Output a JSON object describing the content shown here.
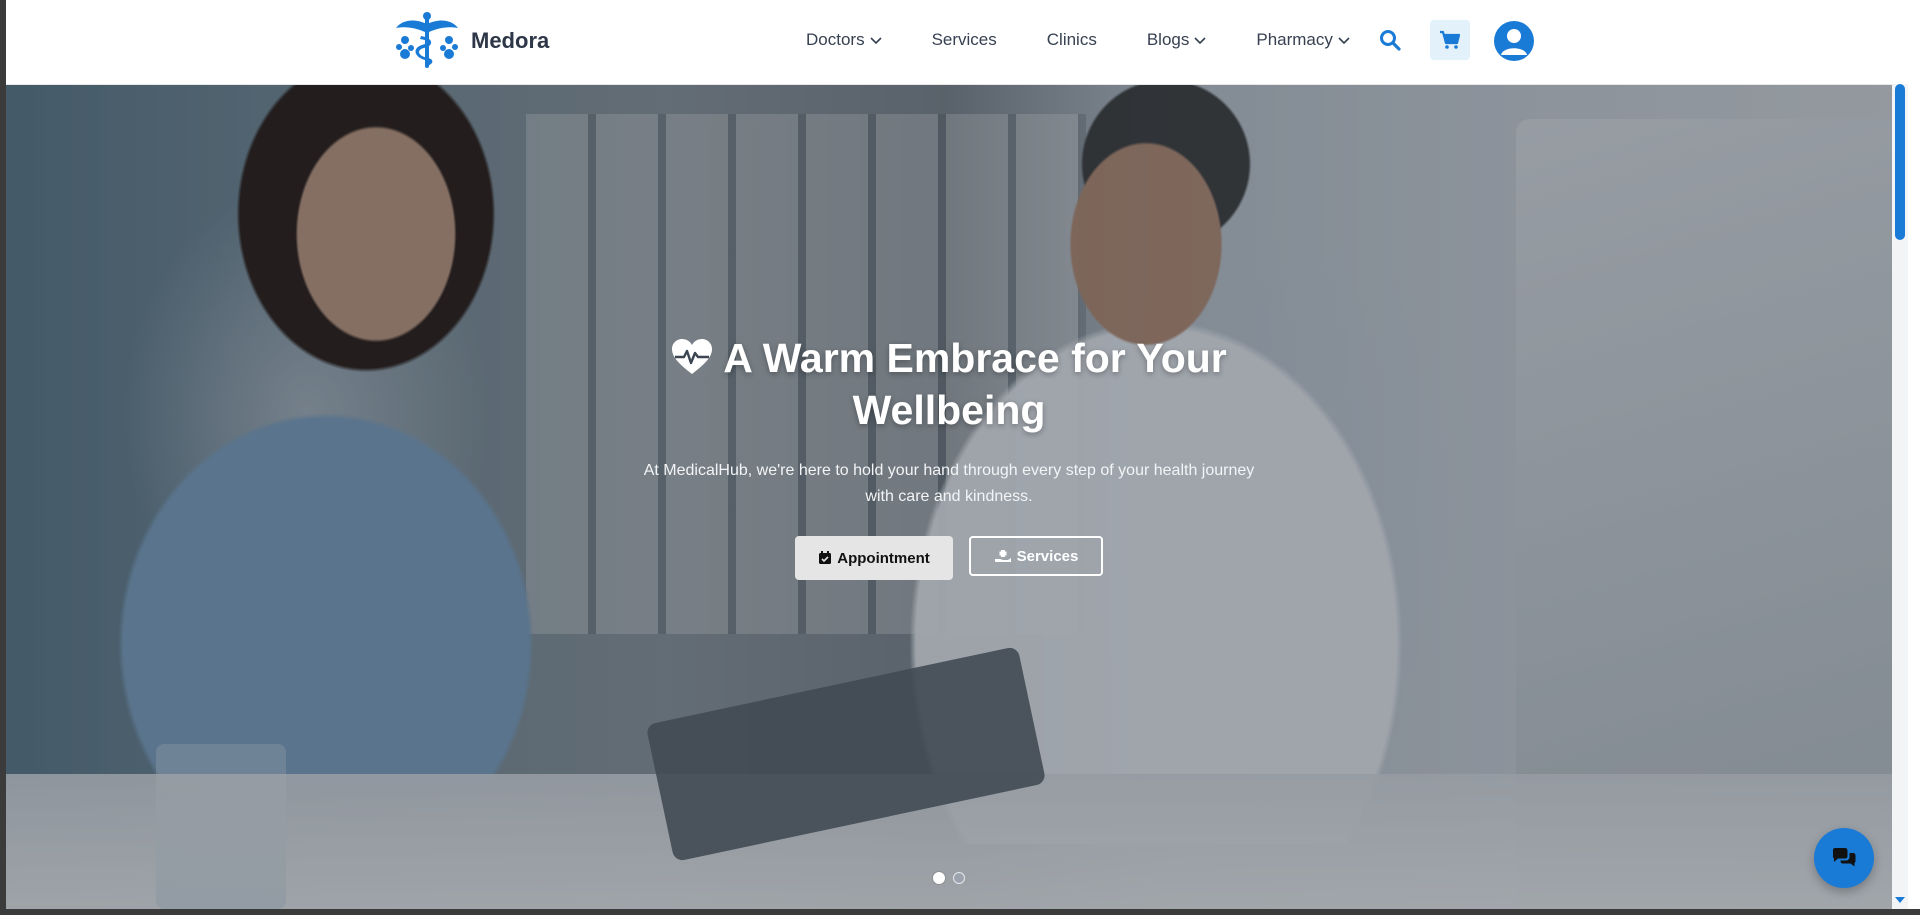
{
  "brand": {
    "name": "Medora"
  },
  "nav": {
    "items": [
      {
        "label": "Doctors",
        "has_dropdown": true
      },
      {
        "label": "Services",
        "has_dropdown": false
      },
      {
        "label": "Clinics",
        "has_dropdown": false
      },
      {
        "label": "Blogs",
        "has_dropdown": true
      },
      {
        "label": "Pharmacy",
        "has_dropdown": true
      }
    ],
    "icons": [
      "search-icon",
      "cart-icon",
      "user-avatar-icon"
    ]
  },
  "hero": {
    "title": "A Warm Embrace for Your Wellbeing",
    "subtitle": "At MedicalHub, we're here to hold your hand through every step of your health journey with care and kindness.",
    "primary_button": "Appointment",
    "secondary_button": "Services",
    "carousel_slide_count": 2,
    "carousel_active_index": 0
  },
  "colors": {
    "accent": "#1a7bd6",
    "cart_bg": "#e3f1fb",
    "nav_text": "#374151",
    "brand_text": "#2d3748"
  }
}
